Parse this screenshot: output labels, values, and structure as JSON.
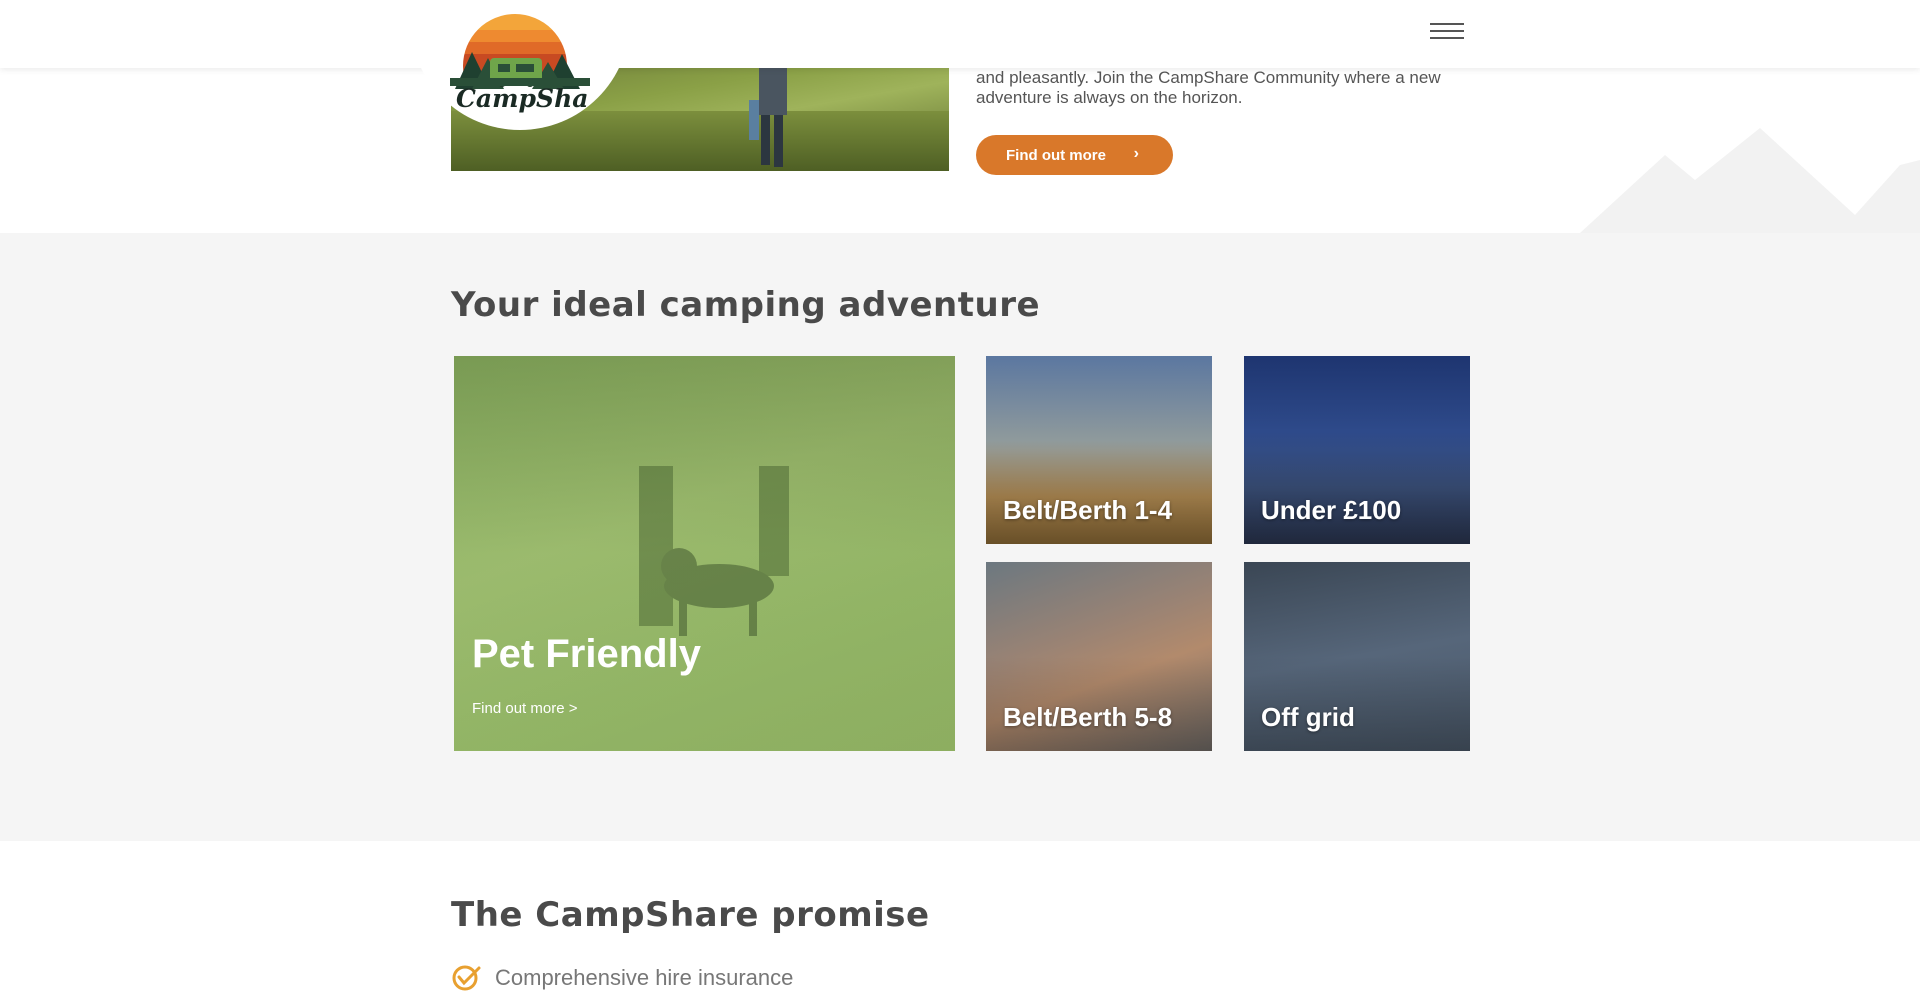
{
  "brand": {
    "logo_text": "CampShare",
    "colors": {
      "accent": "#d9782a",
      "logo_green": "#2f5b3a",
      "tile_green": "#8db365"
    }
  },
  "header": {
    "menu_icon": "hamburger-icon"
  },
  "intro": {
    "text": "and pleasantly. Join the CampShare Community where a new adventure is always on the horizon.",
    "button_label": "Find out more",
    "button_icon": "chevron-right-icon"
  },
  "adventure": {
    "title": "Your ideal camping adventure",
    "featured": {
      "label": "Pet Friendly",
      "link": "Find out more >"
    },
    "tiles": [
      {
        "label": "Belt/Berth 1-4"
      },
      {
        "label": "Under £100"
      },
      {
        "label": "Belt/Berth 5-8"
      },
      {
        "label": "Off grid"
      }
    ]
  },
  "promise": {
    "title": "The CampShare promise",
    "items": [
      {
        "text": "Comprehensive hire insurance",
        "icon": "check-circle-icon"
      }
    ]
  }
}
